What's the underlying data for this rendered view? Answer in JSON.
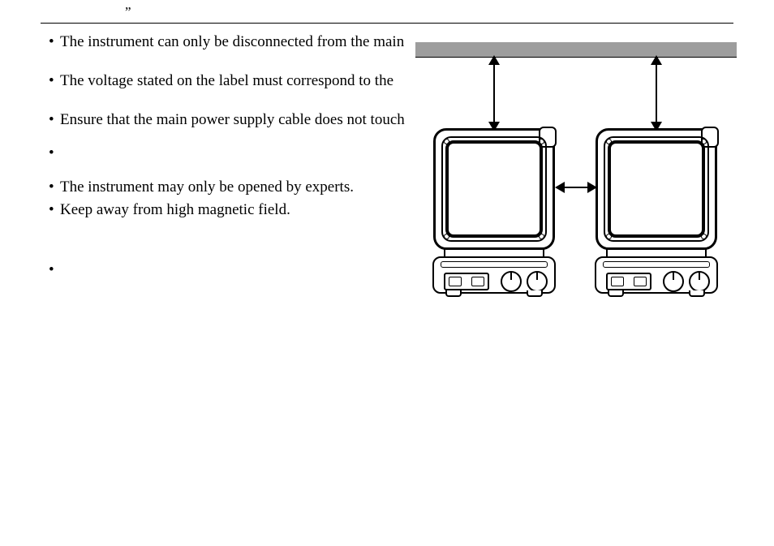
{
  "top_mark": "”",
  "bullets": {
    "b1": "The instrument can only be disconnected from the main",
    "b2": "The voltage stated on the label must correspond to the",
    "b3": "Ensure that the main power supply cable does not touch",
    "b4": "",
    "b5": "The instrument may only be opened by experts.",
    "b6": "Keep away from high magnetic field.",
    "b7": ""
  },
  "bullet_char": "•",
  "figure": {
    "desc": "spacing-diagram",
    "shelf": "overhead-surface",
    "arrows": [
      "vertical-clearance-left",
      "vertical-clearance-right",
      "horizontal-clearance"
    ],
    "device_label": "hotplate-stirrer"
  }
}
